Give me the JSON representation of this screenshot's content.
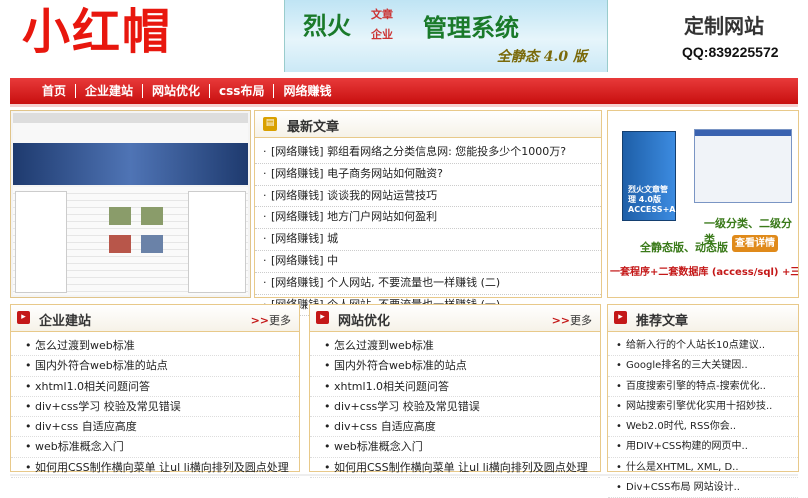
{
  "header": {
    "logo": "小红帽",
    "banner": {
      "part1": "烈火",
      "tag1": "文章",
      "tag2": "企业",
      "part2": "管理系统",
      "version": "全静态 4.0 版"
    },
    "brand": "定制网站",
    "qq": "QQ:839225572"
  },
  "nav": {
    "items": [
      "首页",
      "企业建站",
      "网站优化",
      "css布局",
      "网络赚钱"
    ]
  },
  "latest": {
    "title": "最新文章",
    "items": [
      "[网络赚钱] 郭组看网络之分类信息网: 您能投多少个1000万?",
      "[网络赚钱] 电子商务网站如何融资?",
      "[网络赚钱] 谈谈我的网站运营技巧",
      "[网络赚钱] 地方门户网站如何盈利",
      "[网络赚钱] 城",
      "[网络赚钱] 中",
      "[网络赚钱] 个人网站, 不要流量也一样赚钱 (二)",
      "[网络赚钱] 个人网站, 不要流量也一样赚钱 (一)"
    ]
  },
  "ad": {
    "box_label": "烈火文章管理 4.0版 ACCESS+ASP",
    "line1": "一级分类、二级分类",
    "line2": "全静态版、动态版",
    "button": "查看详情",
    "footer": "一套程序+二套数据库 (access/sql) +三套模板"
  },
  "enterprise": {
    "title": "企业建站",
    "more": "更多",
    "items": [
      "怎么过渡到web标准",
      "国内外符合web标准的站点",
      "xhtml1.0相关问题问答",
      "div+css学习   校验及常见错误",
      "div+css 自适应高度",
      "web标准概念入门",
      "如何用CSS制作横向菜单 让ul li横向排列及圆点处理"
    ]
  },
  "seo": {
    "title": "网站优化",
    "more": "更多",
    "items": [
      "怎么过渡到web标准",
      "国内外符合web标准的站点",
      "xhtml1.0相关问题问答",
      "div+css学习   校验及常见错误",
      "div+css 自适应高度",
      "web标准概念入门",
      "如何用CSS制作横向菜单 让ul li横向排列及圆点处理"
    ]
  },
  "recommend": {
    "title": "推荐文章",
    "items": [
      "给新入行的个人站长10点建议..",
      "Google排名的三大关键因..",
      "百度搜索引擎的特点-搜索优化..",
      "网站搜索引擎优化实用十招妙技..",
      "Web2.0时代, RSS你会..",
      "用DIV+CSS构建的网页中..",
      "什么是XHTML, XML, D..",
      "Div+CSS布局 网站设计.."
    ]
  },
  "colors": {
    "accent": "#c41818",
    "border": "#e8c98a",
    "nav": "#d41e1e"
  }
}
